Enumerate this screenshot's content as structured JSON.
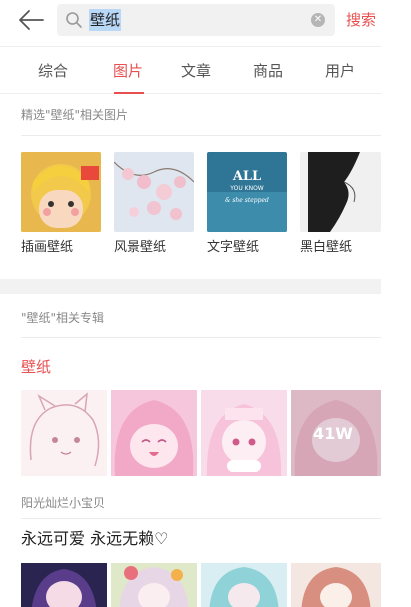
{
  "search": {
    "query": "壁纸",
    "button_label": "搜索"
  },
  "tabs": [
    {
      "label": "综合",
      "active": false
    },
    {
      "label": "图片",
      "active": true
    },
    {
      "label": "文章",
      "active": false
    },
    {
      "label": "商品",
      "active": false
    },
    {
      "label": "用户",
      "active": false
    }
  ],
  "related_images": {
    "heading": "精选\"壁纸\"相关图片",
    "items": [
      {
        "label": "插画壁纸"
      },
      {
        "label": "风景壁纸"
      },
      {
        "label": "文字壁纸",
        "overlay_lines": [
          "ALL",
          "YOU KNOW",
          "& she stepped"
        ]
      },
      {
        "label": "黑白壁纸"
      }
    ]
  },
  "albums": {
    "heading": "\"壁纸\"相关专辑",
    "first": {
      "title": "壁纸",
      "count_overlay": "41W",
      "author": "阳光灿烂小宝贝"
    },
    "second": {
      "title": "永远可爱 永远无赖♡"
    }
  },
  "colors": {
    "accent": "#e85050"
  }
}
